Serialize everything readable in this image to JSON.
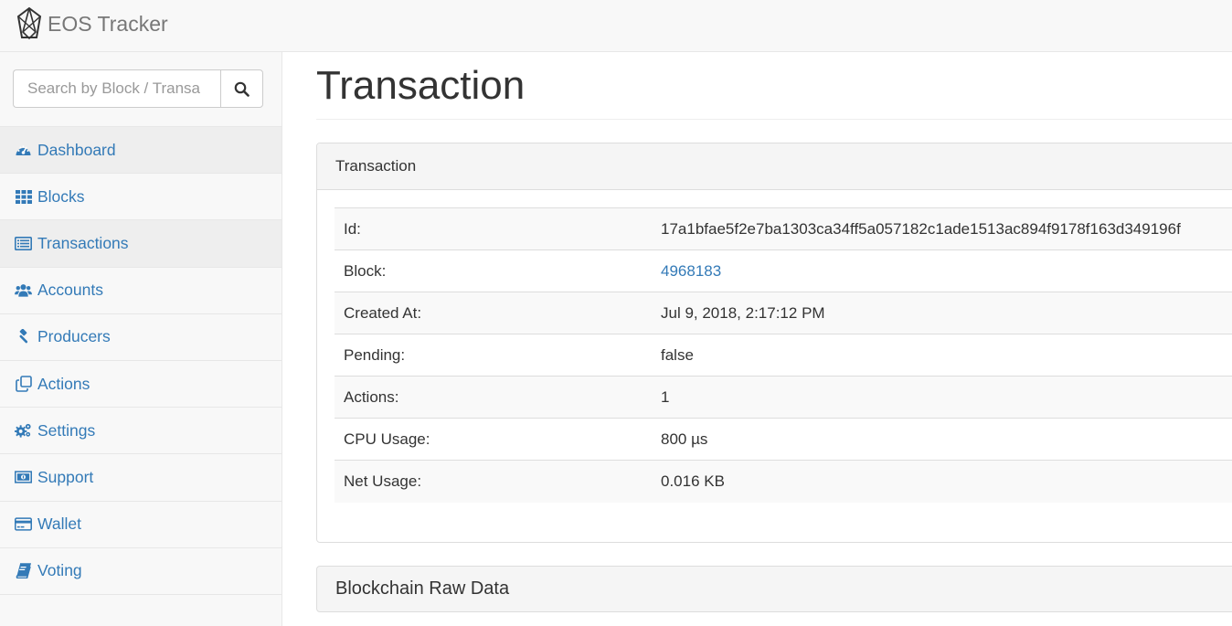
{
  "navbar": {
    "brand": "EOS Tracker"
  },
  "search": {
    "placeholder": "Search by Block / Transa"
  },
  "sidebar": {
    "items": [
      {
        "label": "Dashboard",
        "icon": "dashboard-icon"
      },
      {
        "label": "Blocks",
        "icon": "grid-icon"
      },
      {
        "label": "Transactions",
        "icon": "list-icon"
      },
      {
        "label": "Accounts",
        "icon": "users-icon"
      },
      {
        "label": "Producers",
        "icon": "gavel-icon"
      },
      {
        "label": "Actions",
        "icon": "clone-icon"
      },
      {
        "label": "Settings",
        "icon": "cogs-icon"
      },
      {
        "label": "Support",
        "icon": "money-icon"
      },
      {
        "label": "Wallet",
        "icon": "credit-card-icon"
      },
      {
        "label": "Voting",
        "icon": "book-icon"
      }
    ]
  },
  "main": {
    "title": "Transaction",
    "panel_title": "Transaction",
    "rows": [
      {
        "key": "Id:",
        "value": "17a1bfae5f2e7ba1303ca34ff5a057182c1ade1513ac894f9178f163d349196f"
      },
      {
        "key": "Block:",
        "value": "4968183"
      },
      {
        "key": "Created At:",
        "value": "Jul 9, 2018, 2:17:12 PM"
      },
      {
        "key": "Pending:",
        "value": "false"
      },
      {
        "key": "Actions:",
        "value": "1"
      },
      {
        "key": "CPU Usage:",
        "value": "800 µs"
      },
      {
        "key": "Net Usage:",
        "value": "0.016 KB"
      }
    ],
    "raw_panel_title": "Blockchain Raw Data"
  },
  "colors": {
    "link": "#337ab7",
    "text": "#333333",
    "brand": "#777777"
  }
}
